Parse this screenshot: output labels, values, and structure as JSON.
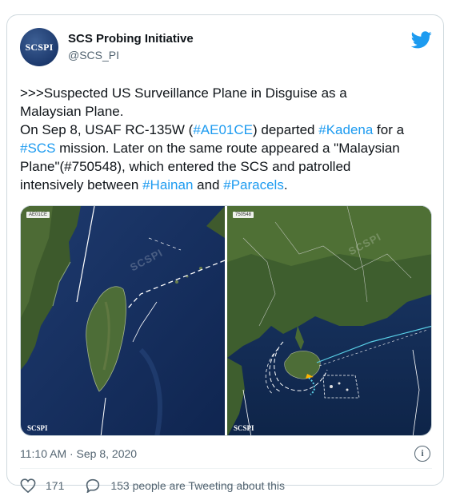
{
  "author": {
    "display_name": "SCS Probing Initiative",
    "handle": "@SCS_PI",
    "avatar_text": "SCSPI"
  },
  "tweet": {
    "lines": [
      [
        {
          "t": ">>>Suspected US Surveillance Plane in Disguise as a",
          "tag": false
        }
      ],
      [
        {
          "t": "Malaysian Plane.",
          "tag": false
        }
      ],
      [
        {
          "t": "On Sep 8, USAF RC-135W (",
          "tag": false
        },
        {
          "t": "#AE01CE",
          "tag": true
        },
        {
          "t": ") departed ",
          "tag": false
        },
        {
          "t": "#Kadena",
          "tag": true
        },
        {
          "t": " for a",
          "tag": false
        }
      ],
      [
        {
          "t": "#SCS",
          "tag": true
        },
        {
          "t": " mission. Later on the same route appeared a \"Malaysian",
          "tag": false
        }
      ],
      [
        {
          "t": "Plane\"(#750548), which entered the SCS and patrolled",
          "tag": false
        }
      ],
      [
        {
          "t": "intensively between ",
          "tag": false
        },
        {
          "t": "#Hainan",
          "tag": true
        },
        {
          "t": " and ",
          "tag": false
        },
        {
          "t": "#Paracels",
          "tag": true
        },
        {
          "t": ".",
          "tag": false
        }
      ]
    ]
  },
  "media": {
    "left_badge": "AE01CE",
    "right_badge": "750548",
    "watermark": "SCSPI",
    "logo": "SCSPI"
  },
  "timestamp": "11:10 AM · Sep 8, 2020",
  "info_glyph": "i",
  "actions": {
    "likes": "171",
    "conversation": "153 people are Tweeting about this"
  },
  "colors": {
    "link": "#1d9bf0",
    "twitter_blue": "#1d9bf0",
    "secondary_text": "#536471",
    "border": "#cfd9de"
  },
  "icons": [
    "twitter-bird-icon",
    "info-icon",
    "heart-icon",
    "speech-bubble-icon"
  ]
}
